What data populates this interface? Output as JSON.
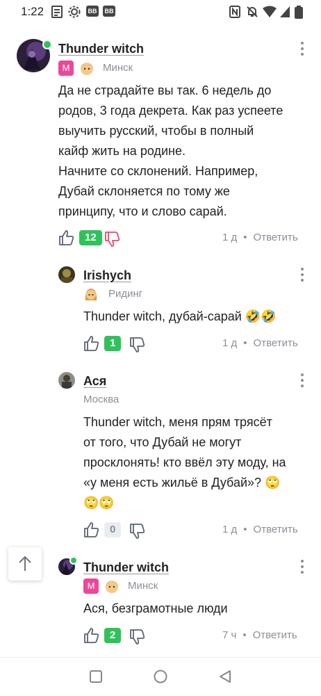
{
  "status_bar": {
    "time": "1:22",
    "badge1": "BB",
    "badge2": "BB"
  },
  "comments": [
    {
      "author": "Thunder witch",
      "badge": "M",
      "city": "Минск",
      "text": "Да не страдайте вы так. 6 недель до\nродов, 3 года декрета. Как раз успеете\nвыучить русский, чтобы в полный\nкайф жить на родине.\nНачните со склонений. Например,\nДубай склоняется по тому же\nпринципу, что и слово сарай.",
      "likes": "12",
      "time": "1 д",
      "sep": "•",
      "reply": "Ответить"
    },
    {
      "author": "Irishych",
      "city": "Ридинг",
      "text": "Thunder witch, дубай-сарай 🤣🤣",
      "likes": "1",
      "time": "1 д",
      "sep": "•",
      "reply": "Ответить"
    },
    {
      "author": "Ася",
      "city": "Москва",
      "text": "Thunder witch, меня прям трясёт\nот того, что Дубай не могут\nпросклонять! кто ввёл эту моду, на\n«у меня есть жильё в Дубай»? 🙄\n🙄🙄",
      "likes": "0",
      "time": "1 д",
      "sep": "•",
      "reply": "Ответить"
    },
    {
      "author": "Thunder witch",
      "badge": "M",
      "city": "Минск",
      "text": "Ася, безграмотные люди",
      "likes": "2",
      "time": "7 ч",
      "sep": "•",
      "reply": "Ответить"
    }
  ],
  "colors": {
    "accent_green": "#2fc25b",
    "badge_pink": "#ec4899",
    "muted": "#8a8f96"
  }
}
